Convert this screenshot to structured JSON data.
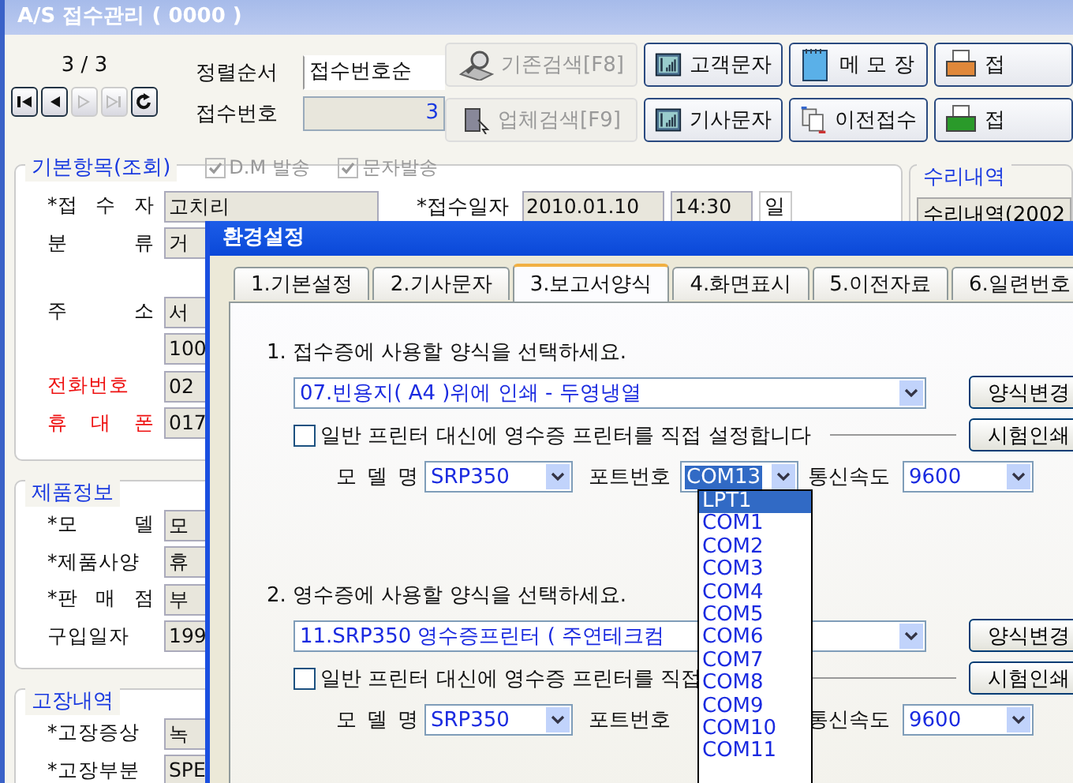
{
  "window": {
    "title": "A/S 접수관리 ( 0000 )"
  },
  "navigator": {
    "position": "3 / 3",
    "buttons": [
      {
        "kind": "first",
        "disabled": false
      },
      {
        "kind": "prev",
        "disabled": false
      },
      {
        "kind": "next",
        "disabled": true
      },
      {
        "kind": "last",
        "disabled": true
      },
      {
        "kind": "refresh",
        "disabled": false
      }
    ]
  },
  "sort": {
    "label": "정렬순서",
    "value": "접수번호순"
  },
  "receipt_no": {
    "label": "접수번호",
    "value": "3"
  },
  "toolbar": [
    {
      "label": "기존검색[F8]",
      "disabled": true
    },
    {
      "label": "고객문자",
      "disabled": false
    },
    {
      "label": "메 모 장",
      "disabled": false
    },
    {
      "label": "접",
      "disabled": false
    },
    {
      "label": "업체검색[F9]",
      "disabled": true
    },
    {
      "label": "기사문자",
      "disabled": false
    },
    {
      "label": "이전접수",
      "disabled": false
    },
    {
      "label": "접",
      "disabled": false
    }
  ],
  "basic": {
    "title": "기본항목(조회)",
    "options": [
      {
        "label": "D.M 발송",
        "checked": true,
        "disabled": true
      },
      {
        "label": "문자발송",
        "checked": true,
        "disabled": true
      }
    ],
    "fields": [
      {
        "label": "*접 수 자",
        "value": "고치리",
        "emphasis": false
      },
      {
        "label": "분 류",
        "value": "거",
        "emphasis": false
      },
      {
        "label": "주 소",
        "value": "서",
        "emphasis": false
      },
      {
        "value": "100"
      },
      {
        "label": "전화번호",
        "value": "02",
        "emphasis": true
      },
      {
        "label": "휴 대 폰",
        "value": "017",
        "emphasis": true
      }
    ],
    "date": {
      "label": "*접수일자",
      "value": "2010.01.10",
      "time": "14:30",
      "weekday": "일"
    }
  },
  "product": {
    "title": "제품정보",
    "fields": [
      {
        "label": "*모 델",
        "value": "모",
        "emphasis": false
      },
      {
        "label": "*제품사양",
        "value": "휴",
        "emphasis": false
      },
      {
        "label": "*판 매 점",
        "value": "부",
        "emphasis": false
      },
      {
        "label": "구입일자",
        "value": "199",
        "emphasis": false
      }
    ]
  },
  "failure": {
    "title": "고장내역",
    "fields": [
      {
        "label": "*고장증상",
        "value": "녹",
        "emphasis": false
      },
      {
        "label": "*고장부분",
        "value": "SPE",
        "emphasis": false
      }
    ]
  },
  "repair": {
    "title": "수리내역",
    "button": "수리내역(2002"
  },
  "dialog": {
    "title": "환경설정",
    "tabs": [
      {
        "label": "1.기본설정",
        "selected": false
      },
      {
        "label": "2.기사문자",
        "selected": false
      },
      {
        "label": "3.보고서양식",
        "selected": true
      },
      {
        "label": "4.화면표시",
        "selected": false
      },
      {
        "label": "5.이전자료",
        "selected": false
      },
      {
        "label": "6.일련번호",
        "selected": false
      }
    ],
    "sections": [
      {
        "prompt": "1. 접수증에 사용할 양식을 선택하세요.",
        "form": "07.빈용지( A4 )위에 인쇄 - 두영냉열",
        "change_button": "양식변경",
        "direct_printer": {
          "label": "일반 프린터 대신에 영수증 프린터를 직접 설정합니다",
          "checked": false
        },
        "test_button": "시험인쇄",
        "model": {
          "label": "모 델 명",
          "value": "SRP350"
        },
        "port": {
          "label": "포트번호",
          "value": "COM13"
        },
        "speed": {
          "label": "통신속도",
          "value": "9600"
        }
      },
      {
        "prompt": "2. 영수증에 사용할 양식을 선택하세요.",
        "form": "11.SRP350 영수증프린터 ( 주연테크컴",
        "change_button": "양식변경",
        "direct_printer": {
          "label": "일반 프린터 대신에 영수증 프린터를 직접",
          "checked": false
        },
        "test_button": "시험인쇄",
        "model": {
          "label": "모 델 명",
          "value": "SRP350"
        },
        "port": {
          "label": "포트번호"
        },
        "speed": {
          "label": "통신속도",
          "value": "9600"
        }
      }
    ],
    "port_list": [
      {
        "label": "LPT1",
        "selected": true
      },
      {
        "label": "COM1",
        "selected": false
      },
      {
        "label": "COM2",
        "selected": false
      },
      {
        "label": "COM3",
        "selected": false
      },
      {
        "label": "COM4",
        "selected": false
      },
      {
        "label": "COM5",
        "selected": false
      },
      {
        "label": "COM6",
        "selected": false
      },
      {
        "label": "COM7",
        "selected": false
      },
      {
        "label": "COM8",
        "selected": false
      },
      {
        "label": "COM9",
        "selected": false
      },
      {
        "label": "COM10",
        "selected": false
      },
      {
        "label": "COM11",
        "selected": false
      }
    ]
  }
}
